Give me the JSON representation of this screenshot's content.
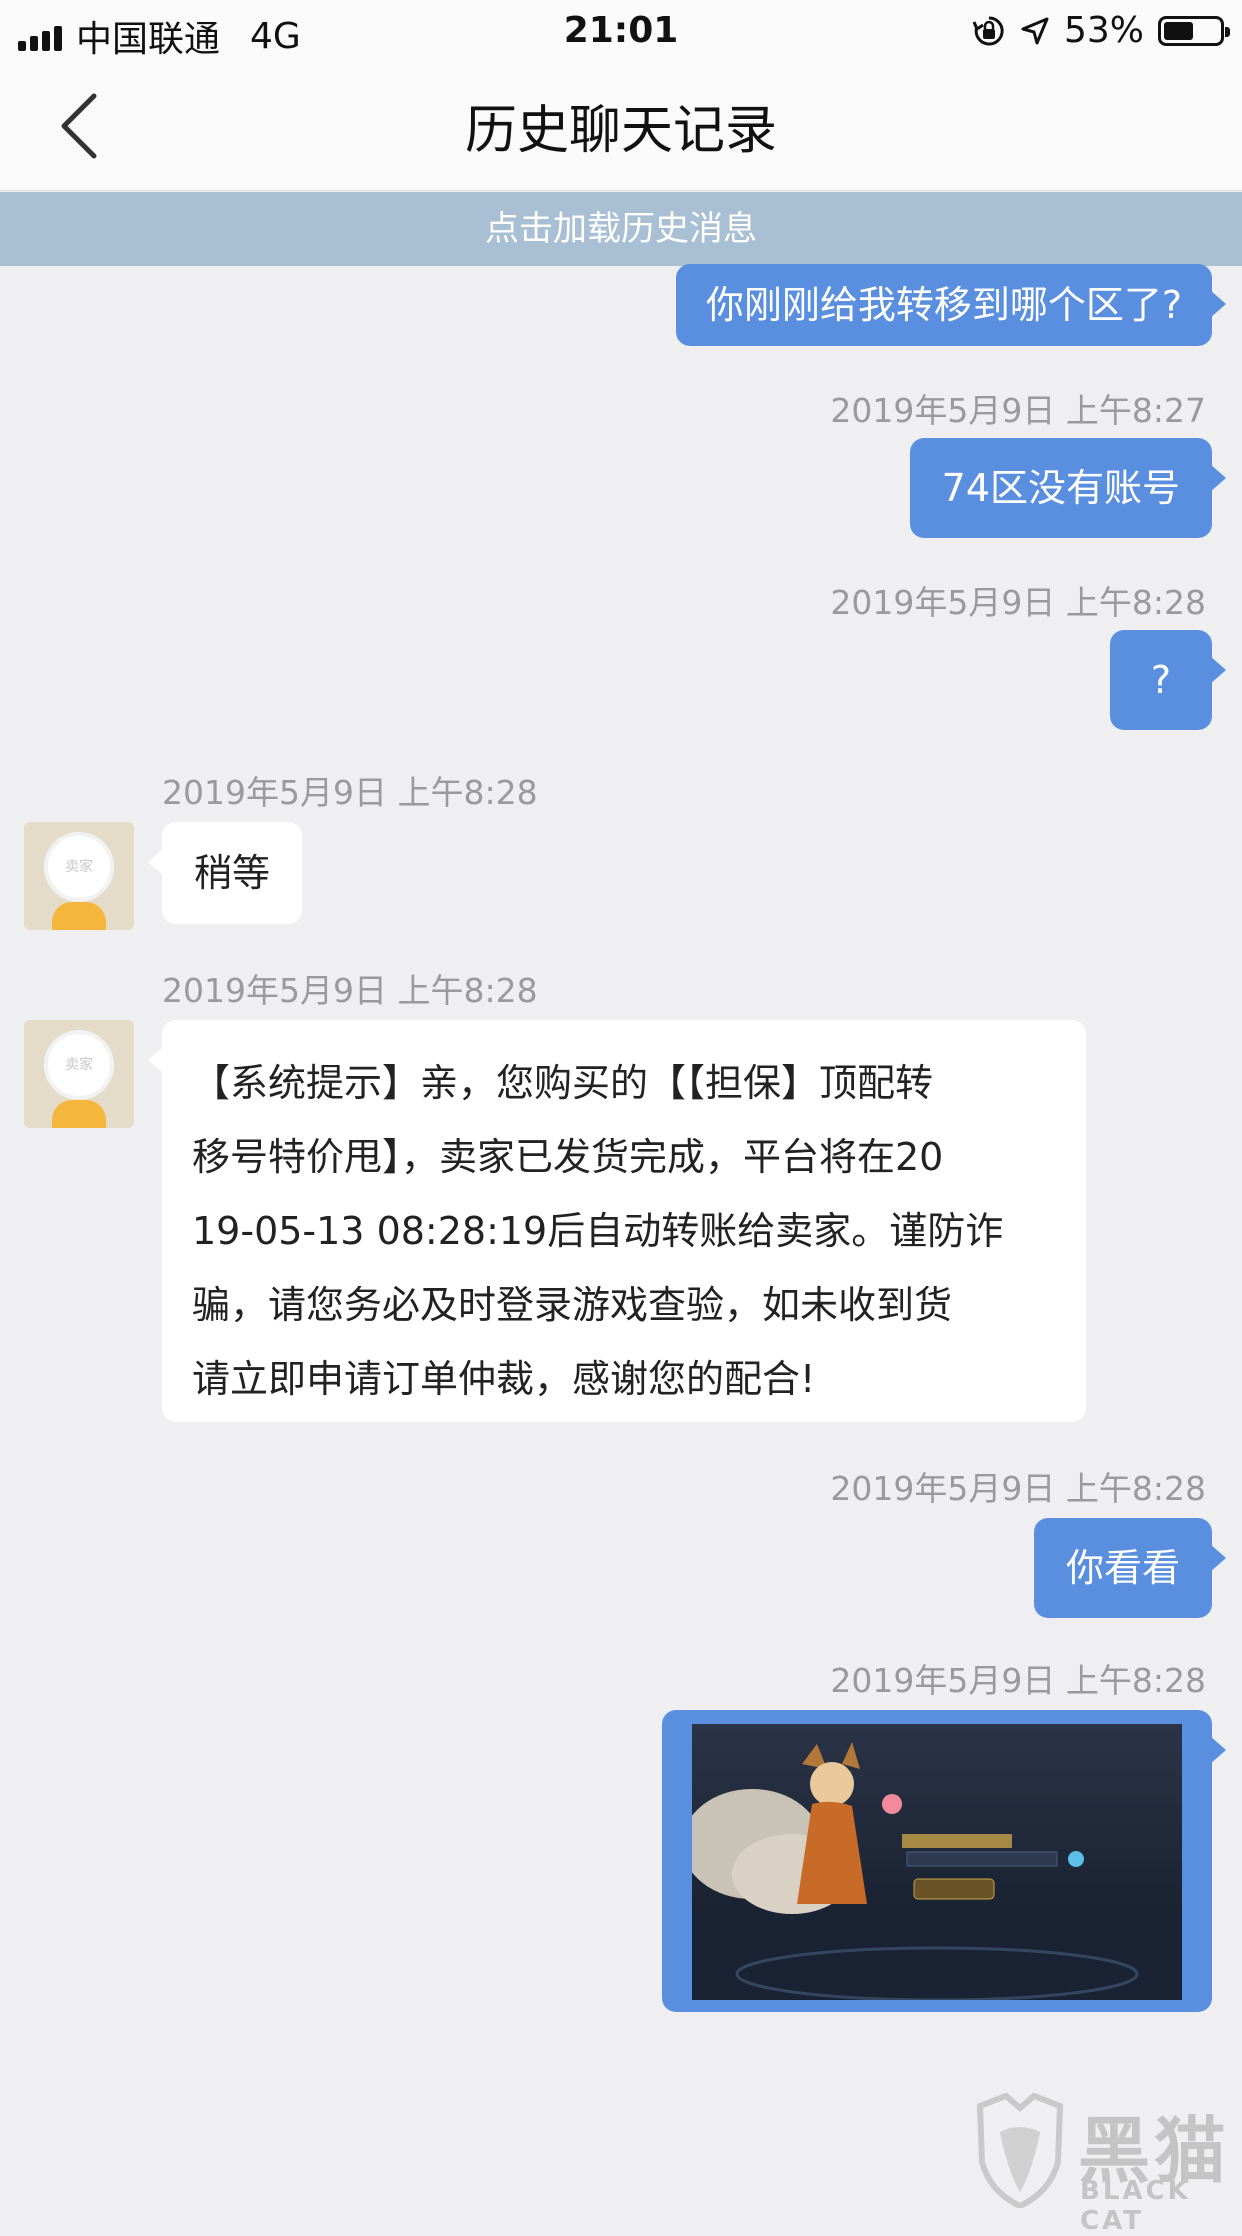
{
  "status_bar": {
    "carrier": "中国联通",
    "network": "4G",
    "time": "21:01",
    "battery": "53%",
    "battery_level": 0.53
  },
  "nav": {
    "title": "历史聊天记录",
    "back_icon": "chevron-left-icon"
  },
  "load_history": "点击加载历史消息",
  "messages": [
    {
      "direction": "out",
      "text": "你刚刚给我转移到哪个区了?"
    },
    {
      "direction": "out",
      "timestamp": "2019年5月9日 上午8:27",
      "text": "74区没有账号"
    },
    {
      "direction": "out",
      "timestamp": "2019年5月9日 上午8:28",
      "text": "?"
    },
    {
      "direction": "in",
      "timestamp": "2019年5月9日 上午8:28",
      "text": "稍等",
      "avatar_label": "卖家"
    },
    {
      "direction": "in",
      "timestamp": "2019年5月9日 上午8:28",
      "avatar_label": "卖家",
      "lines": [
        "【系统提示】亲，您购买的【【担保】顶配转",
        "移号特价甩】，卖家已发货完成，平台将在20",
        "19-05-13 08:28:19后自动转账给卖家。谨防诈",
        "骗，请您务必及时登录游戏查验，如未收到货",
        "请立即申请订单仲裁，感谢您的配合!"
      ]
    },
    {
      "direction": "out",
      "timestamp": "2019年5月9日 上午8:28",
      "text": "你看看"
    },
    {
      "direction": "out",
      "timestamp": "2019年5月9日 上午8:28",
      "type": "image"
    }
  ],
  "watermark": {
    "cn": "黑猫",
    "en": "BLACK CAT"
  },
  "colors": {
    "outgoing_bubble": "#5a8fe0",
    "incoming_bubble": "#ffffff",
    "banner": "#a8bfd4",
    "background": "#efeff1"
  }
}
